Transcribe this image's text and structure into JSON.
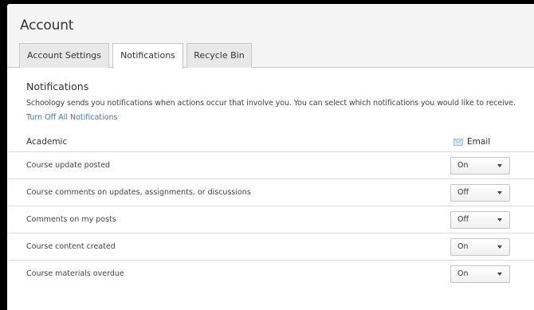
{
  "page": {
    "title": "Account"
  },
  "tabs": [
    {
      "label": "Account Settings"
    },
    {
      "label": "Notifications"
    },
    {
      "label": "Recycle Bin"
    }
  ],
  "section": {
    "title": "Notifications",
    "description": "Schoology sends you notifications when actions occur that involve you. You can select which notifications you would like to receive.",
    "turn_off_link": "Turn Off All Notifications"
  },
  "table": {
    "category": "Academic",
    "email_header": "Email",
    "email_icon": "mail-icon",
    "rows": [
      {
        "label": "Course update posted",
        "value": "On"
      },
      {
        "label": "Course comments on updates, assignments, or discussions",
        "value": "Off"
      },
      {
        "label": "Comments on my posts",
        "value": "Off"
      },
      {
        "label": "Course content created",
        "value": "On"
      },
      {
        "label": "Course materials overdue",
        "value": "On"
      }
    ]
  },
  "colors": {
    "link": "#3a7bbf",
    "mail_icon": "#9cc3e6",
    "border": "#dcdcdc"
  }
}
